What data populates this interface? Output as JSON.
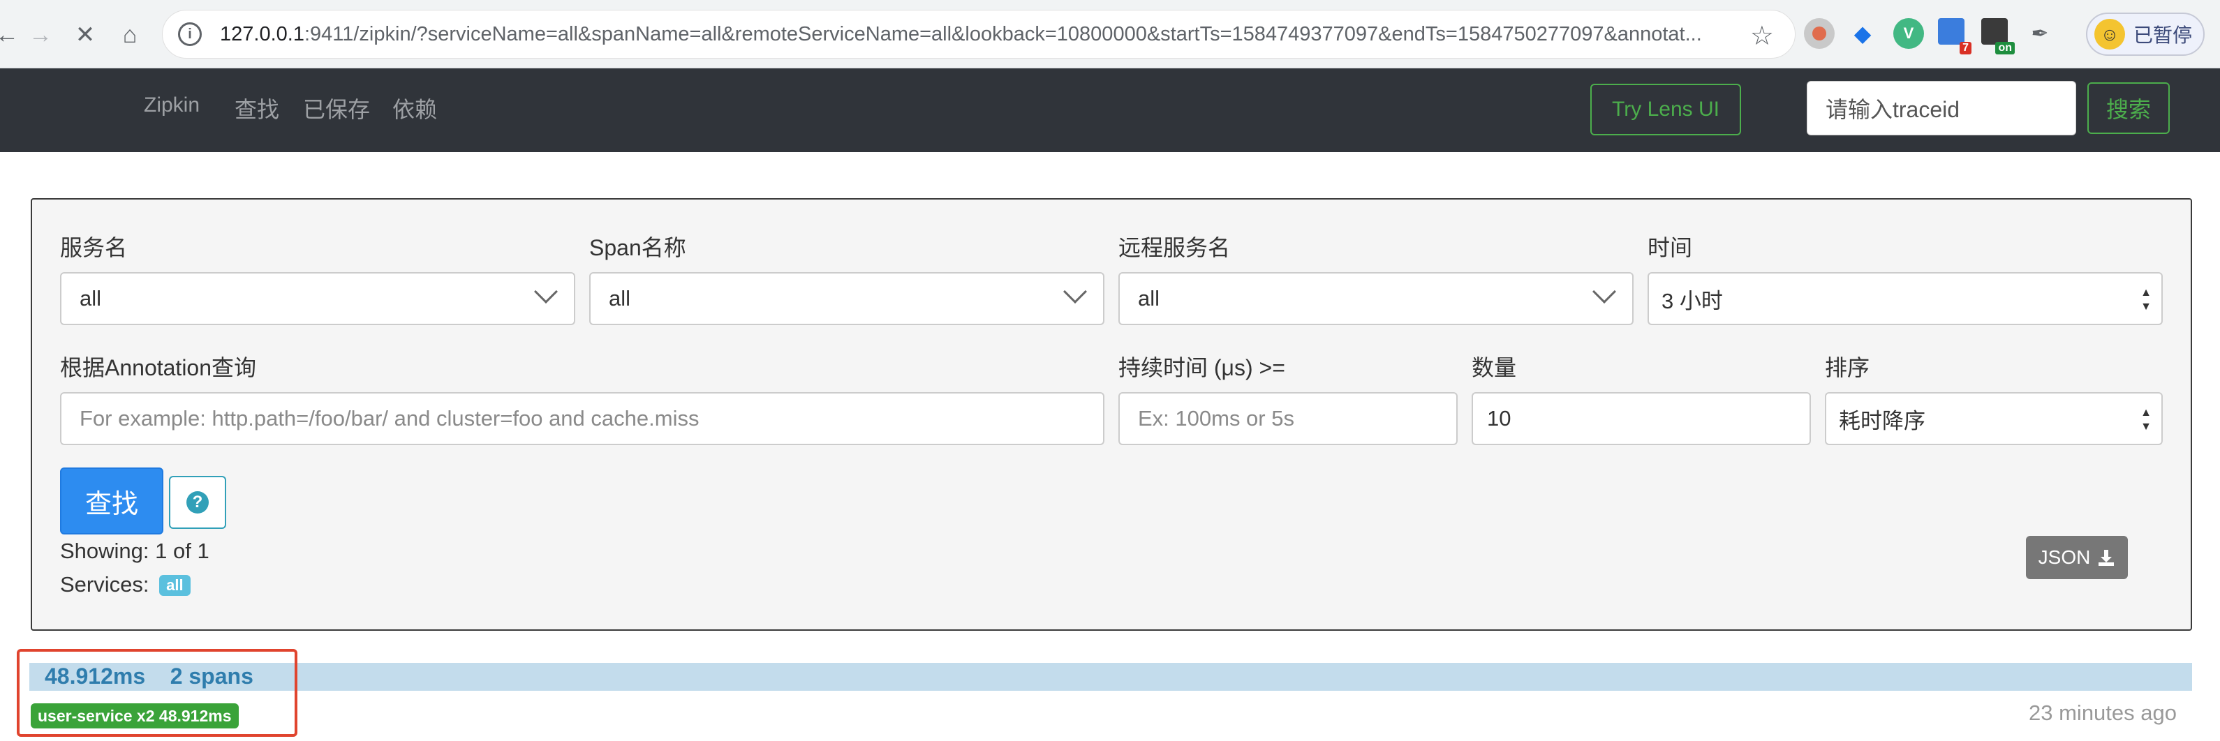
{
  "browser": {
    "url_host": "127.0.0.1",
    "url_rest": ":9411/zipkin/?serviceName=all&spanName=all&remoteServiceName=all&lookback=10800000&startTs=1584749377097&endTs=1584750277097&annotat...",
    "profile_label": "已暂停",
    "ext_badge_7": "7",
    "ext_badge_on": "on"
  },
  "navbar": {
    "brand": "Zipkin",
    "links": [
      "查找",
      "已保存",
      "依赖"
    ],
    "lens_button": "Try Lens UI",
    "traceid_placeholder": "请输入traceid",
    "search_button": "搜索"
  },
  "query": {
    "service_label": "服务名",
    "service_value": "all",
    "span_label": "Span名称",
    "span_value": "all",
    "remote_label": "远程服务名",
    "remote_value": "all",
    "time_label": "时间",
    "time_value": "3 小时",
    "annotation_label": "根据Annotation查询",
    "annotation_placeholder": "For example: http.path=/foo/bar/ and cluster=foo and cache.miss",
    "duration_label": "持续时间 (μs) >=",
    "duration_placeholder": "Ex: 100ms or 5s",
    "limit_label": "数量",
    "limit_value": "10",
    "sort_label": "排序",
    "sort_value": "耗时降序",
    "find_button": "查找",
    "showing": "Showing: 1 of 1",
    "services_label": "Services:",
    "services_badge": "all",
    "json_button": "JSON"
  },
  "trace": {
    "duration": "48.912ms",
    "spans": "2 spans",
    "service_tag": "user-service x2 48.912ms",
    "time_ago": "23 minutes ago"
  },
  "colors": {
    "navbar_bg": "#30343a",
    "accent_green": "#4cae4c",
    "primary_blue": "#2d8cf0",
    "trace_bar": "#c3dcec",
    "highlight_red": "#e0442e"
  }
}
